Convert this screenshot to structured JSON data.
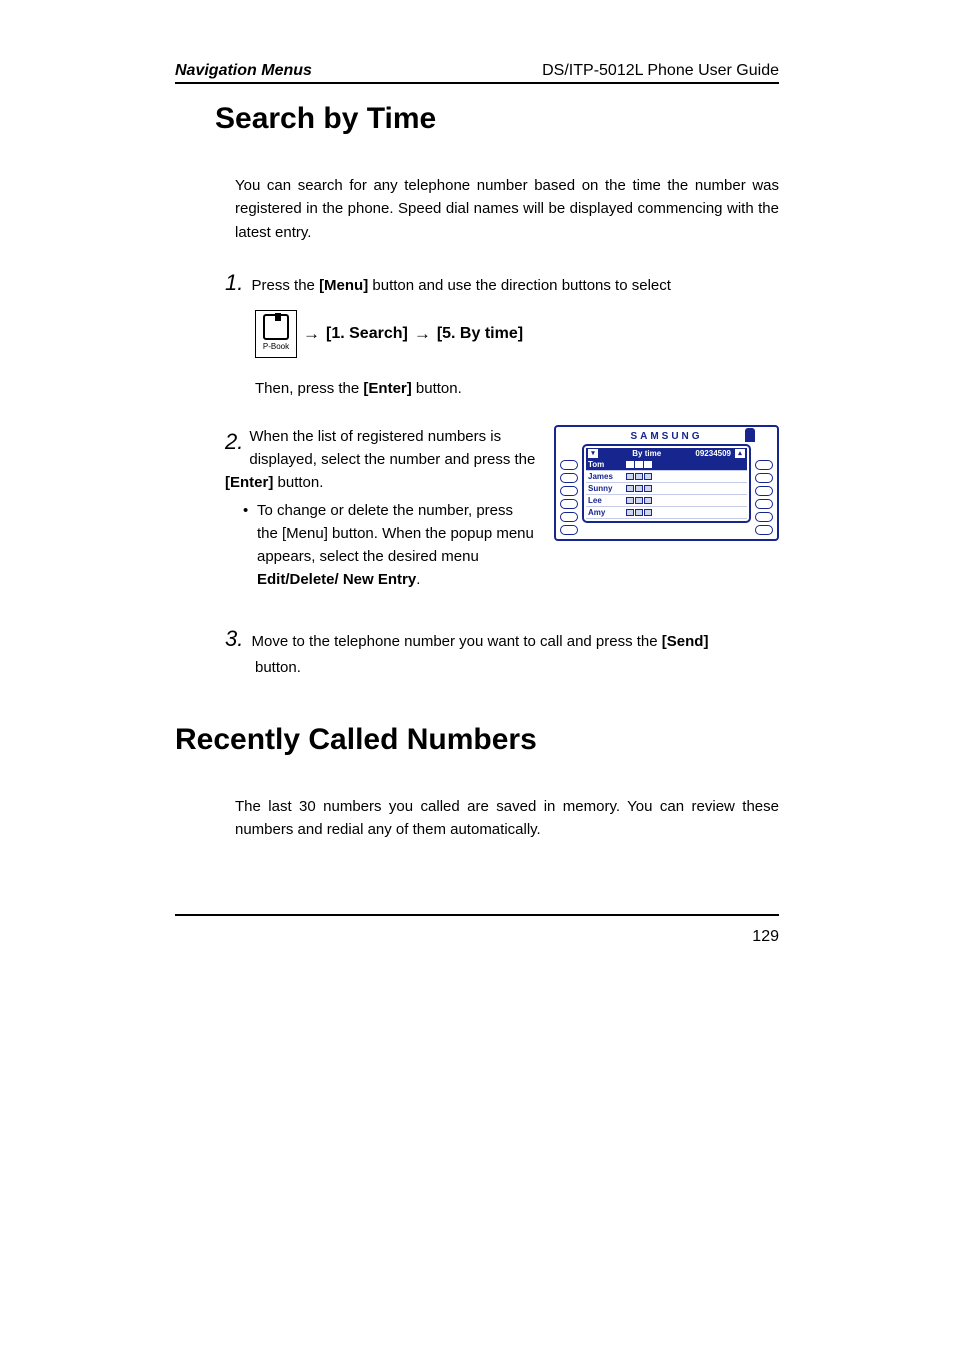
{
  "header": {
    "left": "Navigation Menus",
    "right": "DS/ITP-5012L Phone User Guide"
  },
  "section1": {
    "title": "Search by Time",
    "intro": "You can search for any telephone number based on the time the number was registered in the phone. Speed dial names will be displayed commencing with the latest entry.",
    "step1": {
      "num": "1.",
      "text_a": " Press the ",
      "menu": "[Menu]",
      "text_b": " button and use the direction buttons to select"
    },
    "pbook_label": "P-Book",
    "nav": {
      "seg1": "[1. Search]",
      "seg2": "[5. By time]"
    },
    "then_a": "Then, press the ",
    "then_enter": "[Enter]",
    "then_b": " button.",
    "step2": {
      "num": "2.",
      "line1": "When the list of registered numbers is displayed, select the number and press the ",
      "enter": "[Enter]",
      "line1b": " button.",
      "bullet_a": "To change or delete the number, press the [Menu] button. When the popup menu appears, select the desired menu ",
      "bullet_bold": "Edit/Delete/ New Entry",
      "bullet_b": "."
    },
    "step3": {
      "num": "3.",
      "text_a": "Move to the telephone number you want to call and press the ",
      "send": "[Send]",
      "text_b": " button."
    }
  },
  "figure": {
    "brand": "SAMSUNG",
    "top_label": "By time",
    "top_number": "09234509",
    "rows": [
      {
        "name": "Tom",
        "selected": true
      },
      {
        "name": "James",
        "selected": false
      },
      {
        "name": "Sunny",
        "selected": false
      },
      {
        "name": "Lee",
        "selected": false
      },
      {
        "name": "Amy",
        "selected": false
      }
    ]
  },
  "section2": {
    "title": "Recently Called Numbers",
    "intro": "The last 30 numbers you called are saved in memory. You can review these numbers and redial any of them automatically."
  },
  "page_number": "129",
  "chart_data": null
}
